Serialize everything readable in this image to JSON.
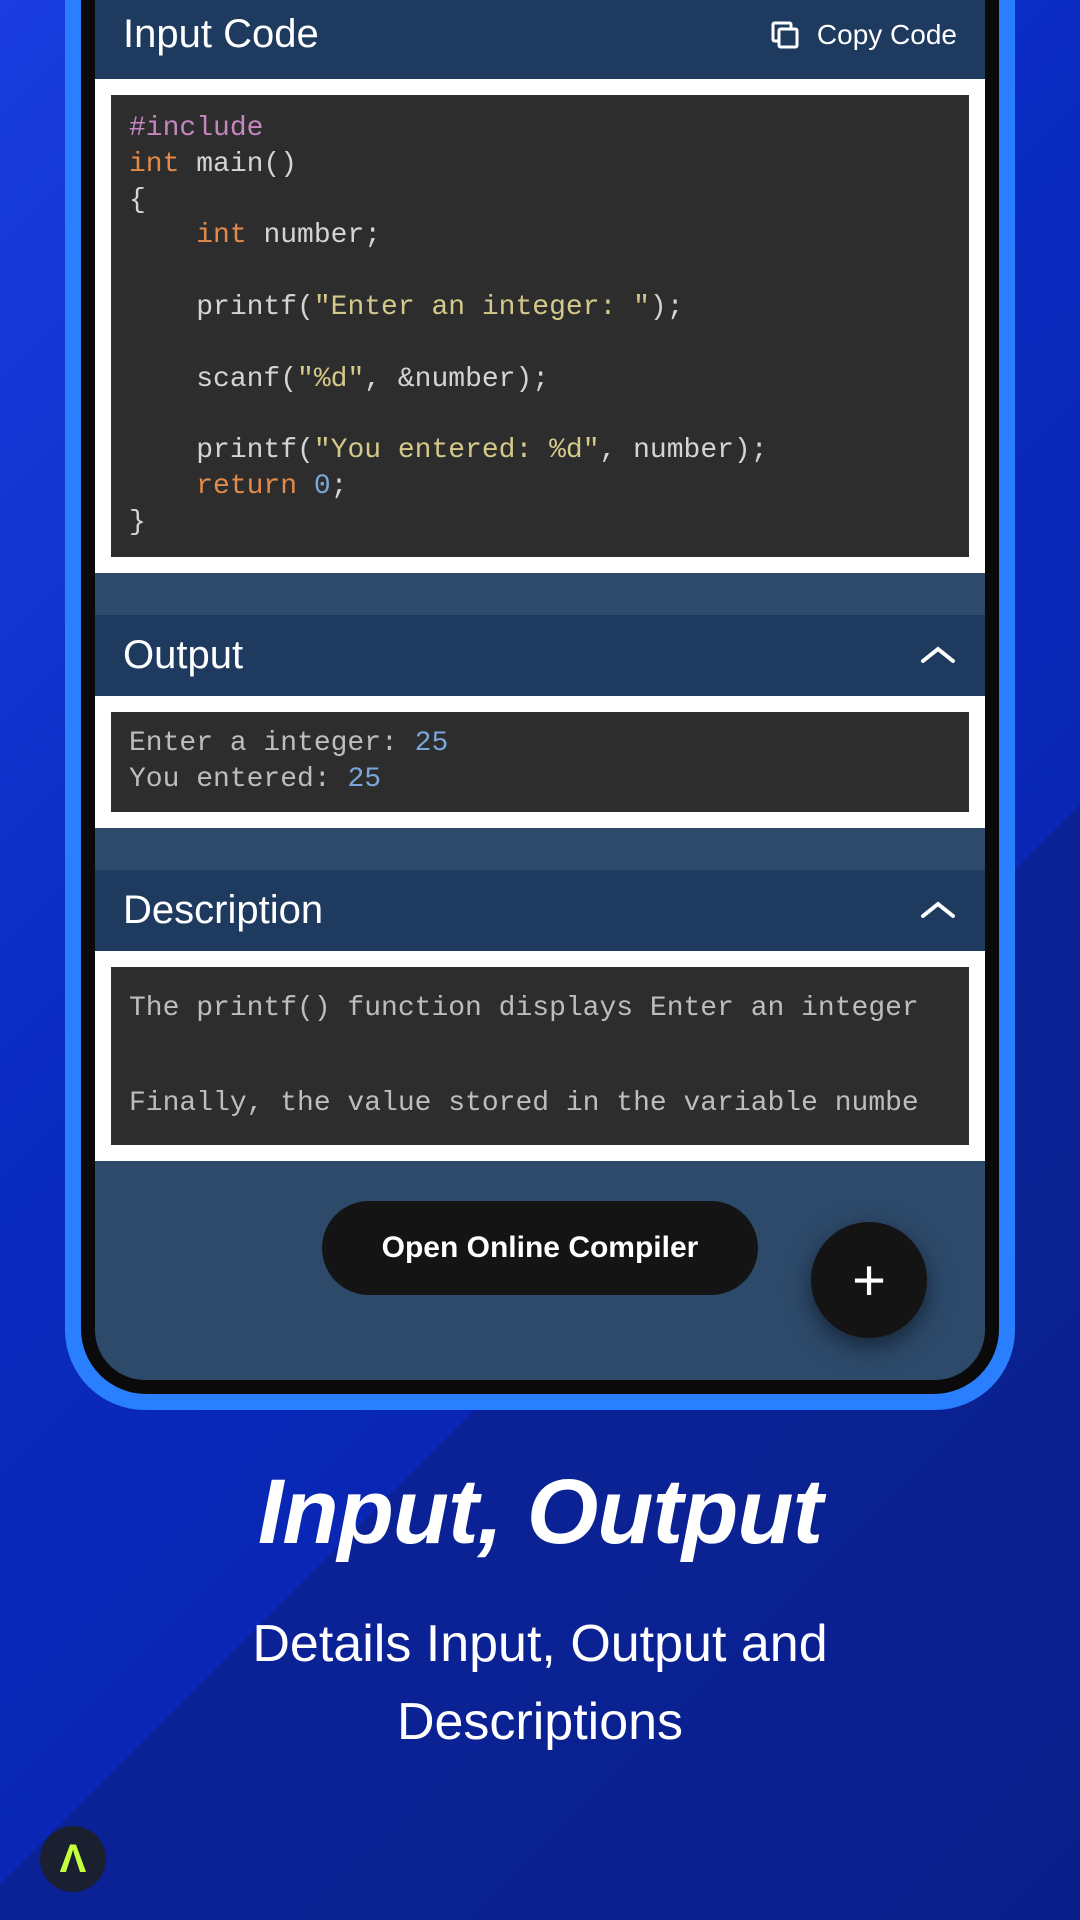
{
  "sections": {
    "input_code": {
      "title": "Input Code",
      "copy_label": "Copy Code",
      "code_tokens": [
        {
          "t": "dir",
          "v": "#include"
        },
        {
          "t": "br"
        },
        {
          "t": "kw",
          "v": "int"
        },
        {
          "t": "punc",
          "v": " main()"
        },
        {
          "t": "br"
        },
        {
          "t": "punc",
          "v": "{"
        },
        {
          "t": "br"
        },
        {
          "t": "punc",
          "v": "    "
        },
        {
          "t": "kw",
          "v": "int"
        },
        {
          "t": "punc",
          "v": " number;"
        },
        {
          "t": "br"
        },
        {
          "t": "br"
        },
        {
          "t": "punc",
          "v": "    printf("
        },
        {
          "t": "str",
          "v": "\"Enter an integer: \""
        },
        {
          "t": "punc",
          "v": ");"
        },
        {
          "t": "br"
        },
        {
          "t": "br"
        },
        {
          "t": "punc",
          "v": "    scanf("
        },
        {
          "t": "str",
          "v": "\"%d\""
        },
        {
          "t": "punc",
          "v": ", &number);"
        },
        {
          "t": "br"
        },
        {
          "t": "br"
        },
        {
          "t": "punc",
          "v": "    printf("
        },
        {
          "t": "str",
          "v": "\"You entered: %d\""
        },
        {
          "t": "punc",
          "v": ", number);"
        },
        {
          "t": "br"
        },
        {
          "t": "punc",
          "v": "    "
        },
        {
          "t": "kw",
          "v": "return"
        },
        {
          "t": "punc",
          "v": " "
        },
        {
          "t": "num",
          "v": "0"
        },
        {
          "t": "punc",
          "v": ";"
        },
        {
          "t": "br"
        },
        {
          "t": "punc",
          "v": "}"
        }
      ]
    },
    "output": {
      "title": "Output",
      "tokens": [
        {
          "t": "txt",
          "v": "Enter a integer: "
        },
        {
          "t": "num",
          "v": "25"
        },
        {
          "t": "br"
        },
        {
          "t": "txt",
          "v": "You entered: "
        },
        {
          "t": "num",
          "v": "25"
        }
      ]
    },
    "description": {
      "title": "Description",
      "line1": "The printf() function displays Enter an integer",
      "line2": "Finally, the value stored in the variable numbe"
    }
  },
  "compiler_button": "Open Online Compiler",
  "fab_glyph": "+",
  "promo": {
    "title": "Input, Output",
    "subtitle_line1": "Details Input, Output and",
    "subtitle_line2": "Descriptions"
  },
  "badge_glyph": "Λ"
}
